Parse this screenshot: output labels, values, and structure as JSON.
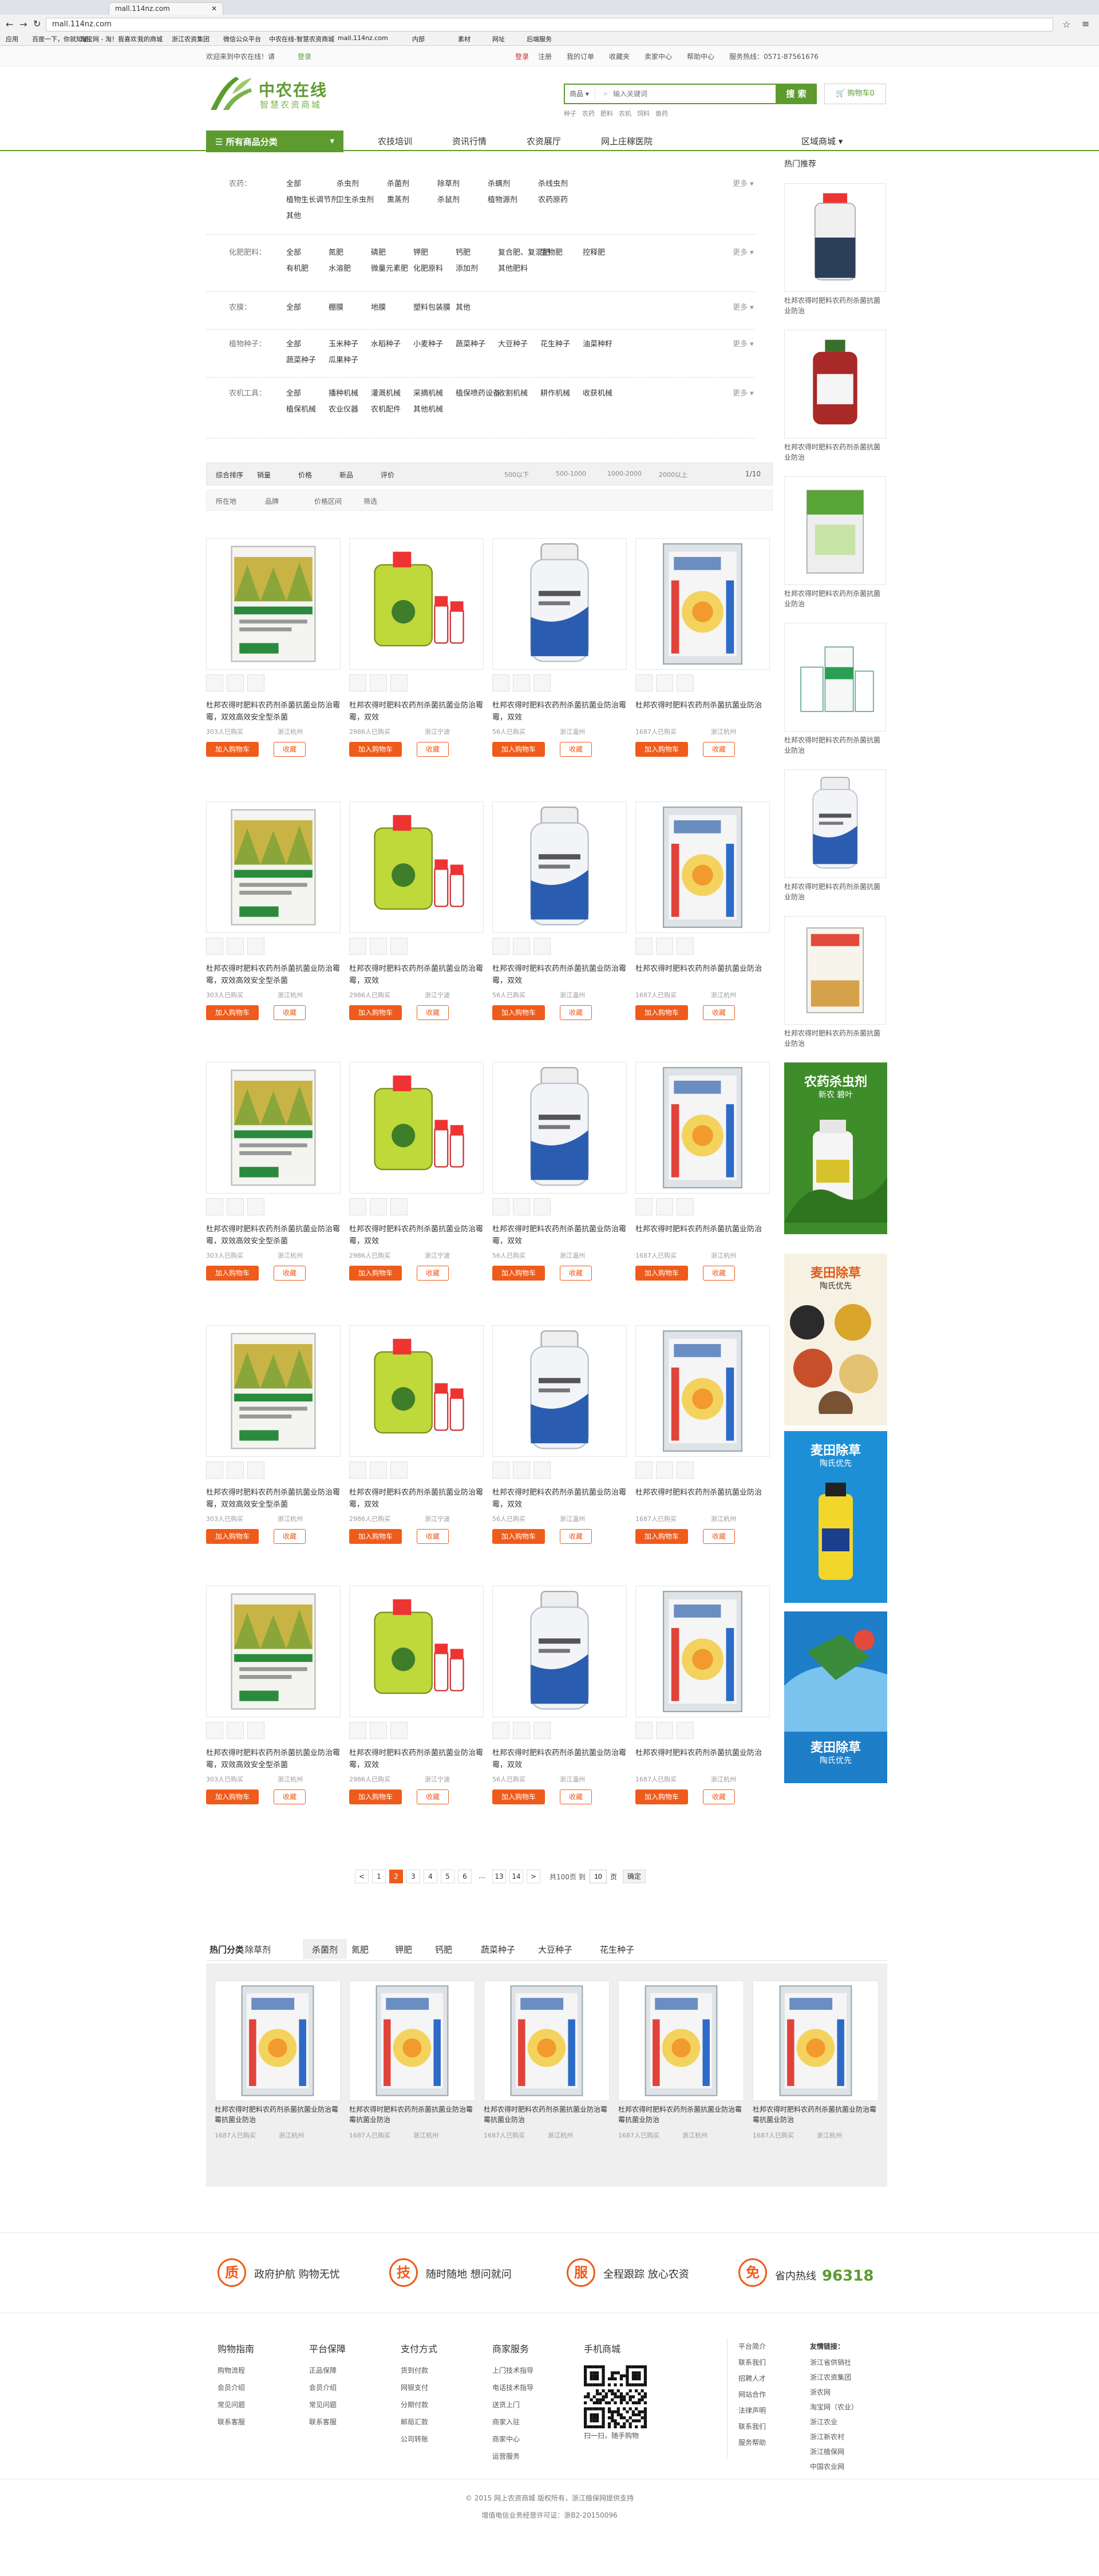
{
  "browser": {
    "tab_title": "mall.114nz.com",
    "address": "mall.114nz.com",
    "bookmarks": [
      "应用",
      "百度一下，你就知道",
      "淘宝网 - 淘！我喜欢",
      "我的商城",
      "浙江农资集团",
      "微信公众平台",
      "中农在线-智慧农资商城",
      "mall.114nz.com",
      "内部",
      "素材",
      "网址",
      "后端服务"
    ]
  },
  "topbar": {
    "welcome": "欢迎来到中农在线！请",
    "login": "登录",
    "register": "注册",
    "links": [
      "我的订单",
      "收藏夹",
      "卖家中心",
      "帮助中心",
      "服务热线：0571-87561676"
    ]
  },
  "header": {
    "logo_title": "中农在线",
    "logo_subtitle": "智慧农资商城",
    "search_type": "商品",
    "search_placeholder": "输入关键词",
    "search_button": "搜 索",
    "cart_label": "购物车0",
    "hot_words": [
      "种子",
      "农药",
      "肥料",
      "农机",
      "饲料",
      "兽药"
    ]
  },
  "nav": {
    "category_button": "所有商品分类",
    "links": [
      "农技培训",
      "资讯行情",
      "农资展厅",
      "网上庄稼医院"
    ],
    "region": "区域商城"
  },
  "filters": [
    {
      "label": "农药：",
      "options": [
        "全部",
        "杀虫剂",
        "杀菌剂",
        "除草剂",
        "杀螨剂",
        "杀线虫剂",
        "植物生长调节剂",
        "卫生杀虫剂",
        "熏蒸剂",
        "杀鼠剂",
        "植物源剂",
        "农药原药",
        "其他"
      ]
    },
    {
      "label": "化肥肥料：",
      "options": [
        "全部",
        "氮肥",
        "磷肥",
        "钾肥",
        "钙肥",
        "复合肥、复混肥",
        "生物肥",
        "控释肥",
        "有机肥",
        "水溶肥",
        "微量元素肥",
        "化肥原料",
        "添加剂",
        "其他肥料"
      ]
    },
    {
      "label": "农膜：",
      "options": [
        "全部",
        "棚膜",
        "地膜",
        "塑料包装膜",
        "其他"
      ]
    },
    {
      "label": "植物种子：",
      "options": [
        "全部",
        "玉米种子",
        "水稻种子",
        "小麦种子",
        "蔬菜种子",
        "大豆种子",
        "花生种子",
        "油菜种籽",
        "蔬菜种子",
        "瓜果种子"
      ]
    },
    {
      "label": "农机工具：",
      "options": [
        "全部",
        "播种机械",
        "灌溉机械",
        "采摘机械",
        "植保喷药设备",
        "收割机械",
        "耕作机械",
        "收获机械",
        "植保机械",
        "农业仪器",
        "农机配件",
        "其他机械"
      ]
    }
  ],
  "filter_more": "更多",
  "sortbar": {
    "items": [
      "综合排序",
      "销量",
      "价格",
      "新品",
      "评价"
    ],
    "price_ranges": [
      "500以下",
      "500-1000",
      "1000-2000",
      "2000以上"
    ],
    "pager": "1/10"
  },
  "sortbar2": {
    "items": [
      "所在地",
      "品牌",
      "价格区间",
      "筛选"
    ]
  },
  "products": [
    {
      "name": "杜邦农得时肥料农药剂杀菌抗菌业防治霉霉，双效高效安全型杀菌",
      "sales": "303人已购买",
      "loc": "浙江杭州",
      "add": "加入购物车",
      "fav": "收藏",
      "type": "rice"
    },
    {
      "name": "杜邦农得时肥料农药剂杀菌抗菌业防治霉霉，双效",
      "sales": "2986人已购买",
      "loc": "浙江宁波",
      "add": "加入购物车",
      "fav": "收藏",
      "type": "green"
    },
    {
      "name": "杜邦农得时肥料农药剂杀菌抗菌业防治霉霉，双效",
      "sales": "56人已购买",
      "loc": "浙江温州",
      "add": "加入购物车",
      "fav": "收藏",
      "type": "bottle"
    },
    {
      "name": "杜邦农得时肥料农药剂杀菌抗菌业防治",
      "sales": "1687人已购买",
      "loc": "浙江杭州",
      "add": "加入购物车",
      "fav": "收藏",
      "type": "bag"
    }
  ],
  "product_grid_rows": 5,
  "sidebar": {
    "title": "热门推荐",
    "items": [
      {
        "name": "杜邦农得时肥料农药剂杀菌抗菌业防治",
        "type": "bottle-dark"
      },
      {
        "name": "杜邦农得时肥料农药剂杀菌抗菌业防治",
        "type": "bottle-red"
      },
      {
        "name": "杜邦农得时肥料农药剂杀菌抗菌业防治",
        "type": "bag-green"
      },
      {
        "name": "杜邦农得时肥料农药剂杀菌抗菌业防治",
        "type": "set"
      },
      {
        "name": "杜邦农得时肥料农药剂杀菌抗菌业防治",
        "type": "bottle"
      },
      {
        "name": "杜邦农得时肥料农药剂杀菌抗菌业防治",
        "type": "bag-pink"
      }
    ],
    "banners": [
      {
        "title": "农药杀虫剂",
        "sub": "新农 碧叶",
        "color": "#3f8c2a"
      },
      {
        "title": "麦田除草",
        "sub": "陶氏优先",
        "color": "#f6f1e2"
      },
      {
        "title": "麦田除草",
        "sub": "陶氏优先",
        "color": "#1d8fd6"
      },
      {
        "title": "麦田除草",
        "sub": "陶氏优先",
        "color": "#1e7ec8"
      }
    ]
  },
  "pagination": {
    "prev": "<",
    "pages": [
      "1",
      "2",
      "3",
      "4",
      "5",
      "6",
      "...",
      "13",
      "14"
    ],
    "active": "2",
    "next": ">",
    "jump_label": "共100页 到",
    "page_input": "10",
    "page_unit": "页",
    "confirm": "确定"
  },
  "recommend": {
    "tabs": [
      "热门分类",
      "除草剂",
      "杀菌剂",
      "氮肥",
      "钾肥",
      "钙肥",
      "蔬菜种子",
      "大豆种子",
      "花生种子"
    ],
    "active_tab": "杀菌剂",
    "items": [
      {
        "name": "杜邦农得时肥料农药剂杀菌抗菌业防治霉霉抗菌业防治",
        "sales": "1687人已购买",
        "loc": "浙江杭州"
      },
      {
        "name": "杜邦农得时肥料农药剂杀菌抗菌业防治霉霉抗菌业防治",
        "sales": "1687人已购买",
        "loc": "浙江杭州"
      },
      {
        "name": "杜邦农得时肥料农药剂杀菌抗菌业防治霉霉抗菌业防治",
        "sales": "1687人已购买",
        "loc": "浙江杭州"
      },
      {
        "name": "杜邦农得时肥料农药剂杀菌抗菌业防治霉霉抗菌业防治",
        "sales": "1687人已购买",
        "loc": "浙江杭州"
      },
      {
        "name": "杜邦农得时肥料农药剂杀菌抗菌业防治霉霉抗菌业防治",
        "sales": "1687人已购买",
        "loc": "浙江杭州"
      }
    ]
  },
  "guarantees": [
    {
      "icon": "质",
      "text": "政府护航 购物无忧"
    },
    {
      "icon": "技",
      "text": "随时随地 想问就问"
    },
    {
      "icon": "服",
      "text": "全程跟踪 放心农资"
    },
    {
      "icon": "免",
      "text": "省内热线",
      "hotline": "96318"
    }
  ],
  "footer_cols": [
    {
      "title": "购物指南",
      "items": [
        "购物流程",
        "会员介绍",
        "常见问题",
        "联系客服"
      ]
    },
    {
      "title": "平台保障",
      "items": [
        "正品保障",
        "会员介绍",
        "常见问题",
        "联系客服"
      ]
    },
    {
      "title": "支付方式",
      "items": [
        "货到付款",
        "网银支付",
        "分期付款",
        "邮局汇款",
        "公司转账"
      ]
    },
    {
      "title": "商家服务",
      "items": [
        "上门技术指导",
        "电话技术指导",
        "送货上门",
        "商家入驻",
        "商家中心",
        "运营服务"
      ]
    },
    {
      "title": "手机商城",
      "items": [
        "扫一扫，随手购物"
      ]
    }
  ],
  "footer_links_left": [
    "平台简介",
    "联系我们",
    "招聘人才",
    "网站合作",
    "法律声明",
    "联系我们",
    "服务帮助"
  ],
  "footer_links_right": {
    "title": "友情链接：",
    "items": [
      "浙江省供销社",
      "浙江农资集团",
      "浙农网",
      "淘宝网（农业）",
      "浙江农业",
      "浙江新农村",
      "浙江植保网",
      "中国农业网"
    ]
  },
  "copyright": "© 2015 网上农资商城 版权所有，浙江植保网提供支持",
  "icp": "增值电信业务经营许可证：浙B2-20150096",
  "colors": {
    "brand_green": "#5d9b2f",
    "accent_orange": "#ef5b1b",
    "annotation_red": "#e02020"
  }
}
